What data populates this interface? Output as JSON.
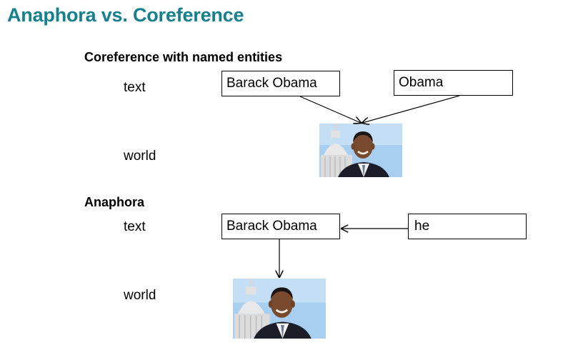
{
  "slide": {
    "title": "Anaphora vs. Coreference"
  },
  "coreference_section": {
    "heading": "Coreference with named entities",
    "text_label": "text",
    "world_label": "world",
    "mention_1": "Barack Obama",
    "mention_2": "Obama",
    "photo_icon": "portrait-photo"
  },
  "anaphora_section": {
    "heading": "Anaphora",
    "text_label": "text",
    "world_label": "world",
    "antecedent": "Barack Obama",
    "anaphor": "he",
    "photo_icon": "portrait-photo"
  },
  "colors": {
    "title": "#17808f",
    "sky": "#a9cff0",
    "suit": "#1b1e28",
    "skin": "#7a4a2e"
  }
}
